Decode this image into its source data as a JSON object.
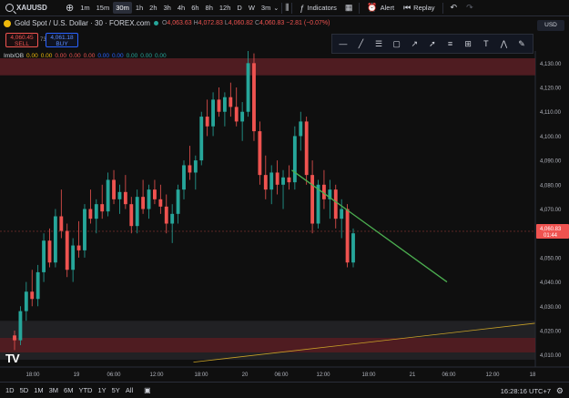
{
  "toolbar": {
    "symbol": "XAUUSD",
    "timeframes": [
      "1m",
      "15m",
      "30m",
      "1h",
      "2h",
      "3h",
      "4h",
      "6h",
      "8h",
      "12h",
      "D",
      "W",
      "3m"
    ],
    "active_timeframe": "30m",
    "indicators_label": "Indicators",
    "alert_label": "Alert",
    "replay_label": "Replay"
  },
  "legend": {
    "title": "Gold Spot / U.S. Dollar · 30 · FOREX.com",
    "o_label": "O",
    "o": "4,063.63",
    "h_label": "H",
    "h": "4,072.83",
    "l_label": "L",
    "l": "4,060.82",
    "c_label": "C",
    "c": "4,060.83",
    "change": "−2.81 (−0.07%)"
  },
  "trade": {
    "sell_price": "4,060.45",
    "sell_label": "SELL",
    "spread": "73",
    "buy_price": "4,061.18",
    "buy_label": "BUY"
  },
  "indicator": {
    "name": "Imb/OB",
    "values": [
      "0.00",
      "0.00",
      "0.00",
      "0.00",
      "0.00",
      "0.00",
      "0.00",
      "0.00",
      "0.00",
      "0.00"
    ]
  },
  "currency": "USD",
  "drawing_tools": [
    "horizontal-line-icon",
    "trend-line-icon",
    "parallel-channel-icon",
    "rectangle-icon",
    "ray-icon",
    "arrow-icon",
    "fib-icon",
    "measure-icon",
    "text-icon",
    "pattern-icon",
    "brush-icon"
  ],
  "price_axis": {
    "ticks": [
      "4,130.00",
      "4,120.00",
      "4,110.00",
      "4,100.00",
      "4,090.00",
      "4,080.00",
      "4,070.00",
      "4,050.00",
      "4,040.00",
      "4,030.00",
      "4,020.00",
      "4,010.00"
    ],
    "last_price": "4,060.83",
    "countdown": "01:44"
  },
  "time_axis": {
    "ticks": [
      "18:00",
      "19",
      "06:00",
      "12:00",
      "18:00",
      "20",
      "06:00",
      "12:00",
      "18:00",
      "21",
      "06:00",
      "12:00",
      "18"
    ]
  },
  "bottom": {
    "ranges": [
      "1D",
      "5D",
      "1M",
      "3M",
      "6M",
      "YTD",
      "1Y",
      "5Y",
      "All"
    ],
    "clock": "16:28:16 UTC+7"
  },
  "colors": {
    "up": "#26a69a",
    "down": "#ef5350",
    "trendline": "#4caf50",
    "support_line": "#c9a227",
    "zone": "#5b1f25"
  },
  "chart_data": {
    "type": "candlestick",
    "symbol": "XAUUSD",
    "interval": "30",
    "ylim": [
      4005,
      4135
    ],
    "last_price": 4060.83,
    "candles": [
      [
        4018,
        4020,
        4012,
        4016
      ],
      [
        4016,
        4030,
        4014,
        4028
      ],
      [
        4028,
        4040,
        4024,
        4036
      ],
      [
        4036,
        4045,
        4030,
        4033
      ],
      [
        4033,
        4047,
        4030,
        4044
      ],
      [
        4044,
        4060,
        4040,
        4057
      ],
      [
        4057,
        4062,
        4046,
        4048
      ],
      [
        4048,
        4070,
        4046,
        4067
      ],
      [
        4067,
        4078,
        4058,
        4061
      ],
      [
        4061,
        4064,
        4042,
        4045
      ],
      [
        4045,
        4058,
        4040,
        4055
      ],
      [
        4055,
        4065,
        4050,
        4053
      ],
      [
        4053,
        4072,
        4050,
        4070
      ],
      [
        4070,
        4078,
        4064,
        4066
      ],
      [
        4066,
        4074,
        4060,
        4072
      ],
      [
        4072,
        4080,
        4066,
        4069
      ],
      [
        4069,
        4085,
        4067,
        4082
      ],
      [
        4082,
        4086,
        4072,
        4074
      ],
      [
        4074,
        4080,
        4068,
        4077
      ],
      [
        4077,
        4084,
        4070,
        4072
      ],
      [
        4072,
        4075,
        4060,
        4063
      ],
      [
        4063,
        4078,
        4060,
        4075
      ],
      [
        4075,
        4082,
        4068,
        4070
      ],
      [
        4070,
        4080,
        4066,
        4078
      ],
      [
        4078,
        4082,
        4072,
        4074
      ],
      [
        4074,
        4080,
        4068,
        4071
      ],
      [
        4071,
        4076,
        4060,
        4064
      ],
      [
        4064,
        4072,
        4056,
        4068
      ],
      [
        4068,
        4080,
        4064,
        4078
      ],
      [
        4078,
        4090,
        4074,
        4088
      ],
      [
        4088,
        4096,
        4082,
        4085
      ],
      [
        4085,
        4092,
        4078,
        4090
      ],
      [
        4090,
        4110,
        4088,
        4108
      ],
      [
        4108,
        4115,
        4100,
        4104
      ],
      [
        4104,
        4118,
        4100,
        4115
      ],
      [
        4115,
        4120,
        4108,
        4110
      ],
      [
        4110,
        4118,
        4104,
        4116
      ],
      [
        4116,
        4122,
        4108,
        4112
      ],
      [
        4112,
        4120,
        4104,
        4106
      ],
      [
        4106,
        4114,
        4098,
        4110
      ],
      [
        4110,
        4135,
        4108,
        4130
      ],
      [
        4130,
        4134,
        4098,
        4102
      ],
      [
        4102,
        4106,
        4080,
        4084
      ],
      [
        4084,
        4092,
        4074,
        4078
      ],
      [
        4078,
        4088,
        4072,
        4085
      ],
      [
        4085,
        4090,
        4076,
        4080
      ],
      [
        4080,
        4086,
        4070,
        4083
      ],
      [
        4083,
        4088,
        4078,
        4081
      ],
      [
        4081,
        4104,
        4078,
        4100
      ],
      [
        4100,
        4110,
        4094,
        4106
      ],
      [
        4106,
        4108,
        4080,
        4084
      ],
      [
        4084,
        4090,
        4060,
        4064
      ],
      [
        4064,
        4082,
        4062,
        4080
      ],
      [
        4080,
        4086,
        4070,
        4074
      ],
      [
        4074,
        4082,
        4066,
        4078
      ],
      [
        4078,
        4080,
        4062,
        4066
      ],
      [
        4066,
        4074,
        4058,
        4070
      ],
      [
        4070,
        4072,
        4046,
        4048
      ],
      [
        4048,
        4062,
        4046,
        4060
      ]
    ],
    "annotations": [
      {
        "type": "trendline",
        "from": [
          4086,
          0.545
        ],
        "to": [
          4040,
          0.835
        ]
      },
      {
        "type": "support_line",
        "from": [
          4007,
          0.34
        ],
        "to": [
          4023,
          0.94
        ]
      },
      {
        "type": "zone",
        "range": [
          4125,
          4132
        ]
      },
      {
        "type": "zone",
        "range": [
          4011,
          4017
        ]
      }
    ]
  }
}
